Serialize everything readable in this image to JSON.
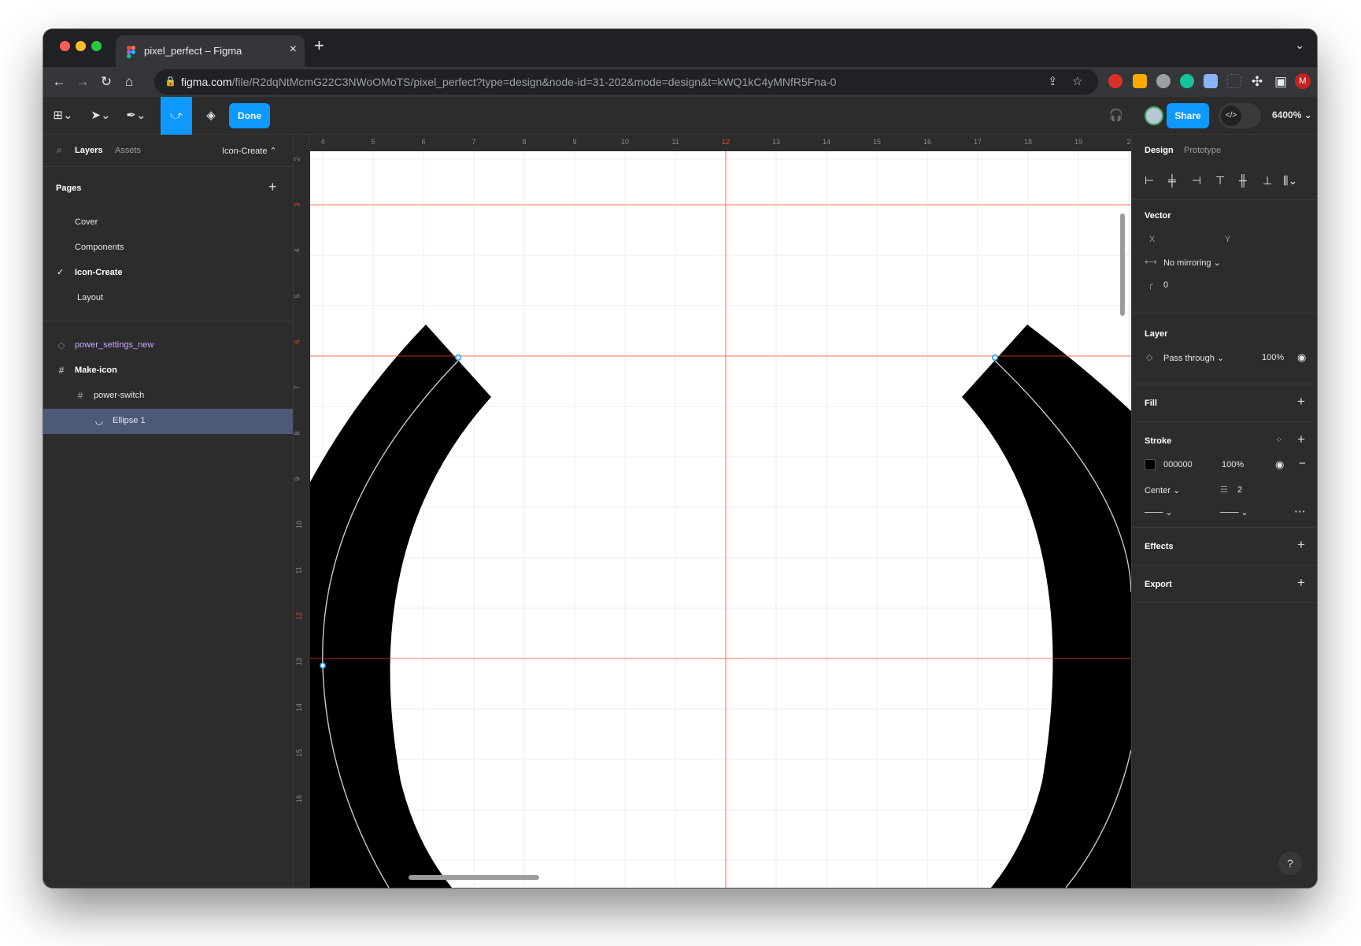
{
  "browser": {
    "tab_title": "pixel_perfect – Figma",
    "tab_close": "×",
    "new_tab": "+",
    "url_host": "figma.com",
    "url_path": "/file/R2dqNtMcmG22C3NWoOMoTS/pixel_perfect?type=design&node-id=31-202&mode=design&t=kWQ1kC4yMNfR5Fna-0",
    "profile_initial": "M",
    "icons": [
      "back-icon",
      "forward-icon",
      "reload-icon",
      "home-icon",
      "lock-icon",
      "share-page-icon",
      "bookmark-star-icon",
      "extensions-icon",
      "side-panel-icon",
      "menu-dots-icon"
    ]
  },
  "toolbar": {
    "done_label": "Done",
    "share_label": "Share",
    "zoom_label": "6400% ⌄",
    "icons": [
      "figma-menu-icon",
      "move-tool-icon",
      "pen-tool-icon",
      "bend-tool-icon",
      "paint-bucket-icon",
      "headphones-icon",
      "dev-mode-icon"
    ]
  },
  "left_panel": {
    "tabs": [
      "Layers",
      "Assets"
    ],
    "current_page_switch": "Icon-Create ⌃",
    "pages_heading": "Pages",
    "pages": [
      {
        "label": "Cover",
        "active": false
      },
      {
        "label": "Components",
        "active": false
      },
      {
        "label": "Icon-Create",
        "active": true
      },
      {
        "label": "Layout",
        "active": false
      }
    ],
    "layers": [
      {
        "label": "power_settings_new",
        "icon": "component-icon",
        "type": "component"
      },
      {
        "label": "Make-icon",
        "icon": "frame-icon",
        "type": "frame"
      },
      {
        "label": "power-switch",
        "icon": "frame-icon",
        "type": "frame"
      },
      {
        "label": "Ellipse 1",
        "icon": "ellipse-arc-icon",
        "type": "selected"
      }
    ]
  },
  "rulers": {
    "top": [
      "4",
      "5",
      "6",
      "7",
      "8",
      "9",
      "10",
      "11",
      "12",
      "13",
      "14",
      "15",
      "16",
      "17",
      "18",
      "19",
      "2"
    ],
    "left": [
      "2",
      "3",
      "4",
      "5",
      "6",
      "7",
      "8",
      "9",
      "10",
      "11",
      "12",
      "13",
      "14",
      "15",
      "16"
    ]
  },
  "right_panel": {
    "tabs": [
      "Design",
      "Prototype"
    ],
    "vector": {
      "heading": "Vector",
      "x_label": "X",
      "y_label": "Y",
      "mirroring": "No mirroring ⌄",
      "corner": "0"
    },
    "layer": {
      "heading": "Layer",
      "blend": "Pass through ⌄",
      "opacity": "100%"
    },
    "fill": {
      "heading": "Fill"
    },
    "stroke": {
      "heading": "Stroke",
      "color_hex": "000000",
      "opacity": "100%",
      "position": "Center ⌄",
      "weight": "2"
    },
    "effects": {
      "heading": "Effects"
    },
    "export": {
      "heading": "Export"
    },
    "help": "?"
  },
  "colors": {
    "accent": "#0d99ff",
    "guide": "#f24822",
    "selection": "#4c5a78",
    "component": "#c8a7ff",
    "stroke_color": "#000000"
  }
}
